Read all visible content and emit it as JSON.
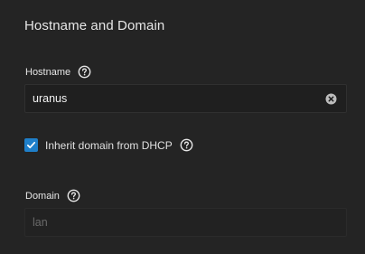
{
  "section": {
    "title": "Hostname and Domain"
  },
  "hostname": {
    "label": "Hostname",
    "value": "uranus"
  },
  "inherit_domain": {
    "label": "Inherit domain from DHCP",
    "checked": true
  },
  "domain": {
    "label": "Domain",
    "value": "lan"
  },
  "icons": {
    "help": "help-circle-icon",
    "clear": "clear-circle-icon",
    "check": "checkmark-icon"
  },
  "colors": {
    "background": "#242424",
    "accent": "#1f7fc9"
  }
}
